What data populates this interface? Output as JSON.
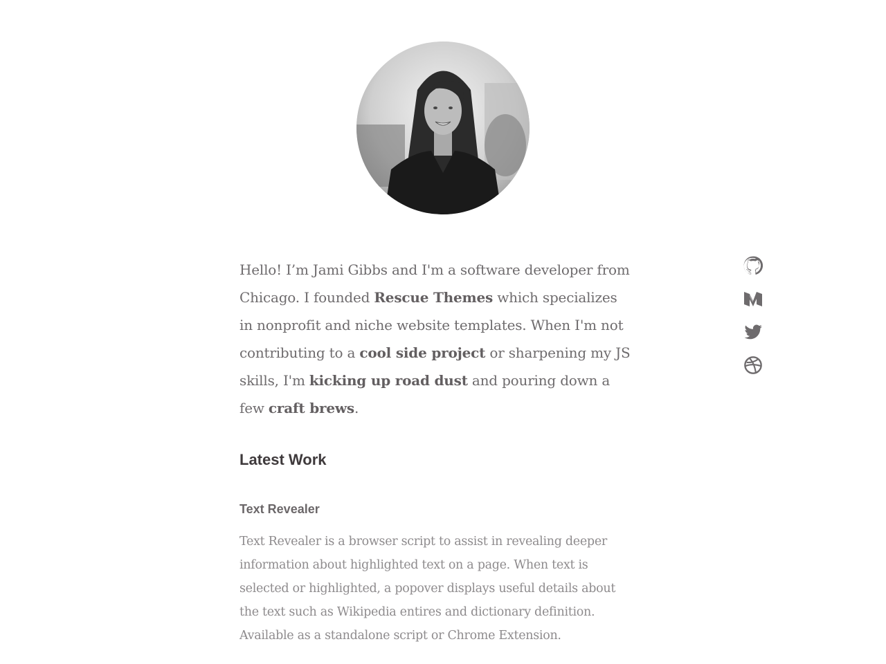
{
  "profile": {
    "intro": {
      "t1": "Hello! I’m Jami Gibbs and I'm a software developer from Chicago. I founded ",
      "link1": "Rescue Themes",
      "t2": " which specializes in nonprofit and niche website templates. When I'm not contributing to a ",
      "link2": "cool side project",
      "t3": " or sharpening my JS skills, I'm ",
      "link3": "kicking up road dust",
      "t4": " and pouring down a few ",
      "link4": "craft brews",
      "t5": "."
    }
  },
  "social": {
    "items": [
      {
        "icon": "github-icon"
      },
      {
        "icon": "medium-icon"
      },
      {
        "icon": "twitter-icon"
      },
      {
        "icon": "dribbble-icon"
      }
    ],
    "icon_color": "#6e6b6d"
  },
  "latest_work": {
    "heading": "Latest Work",
    "projects": [
      {
        "title": "Text Revealer",
        "description": "Text Revealer is a browser script to assist in revealing deeper information about highlighted text on a page. When text is selected or highlighted, a popover displays useful details about the text such as Wikipedia entires and dictionary definition. Available as a standalone script or Chrome Extension."
      }
    ]
  }
}
